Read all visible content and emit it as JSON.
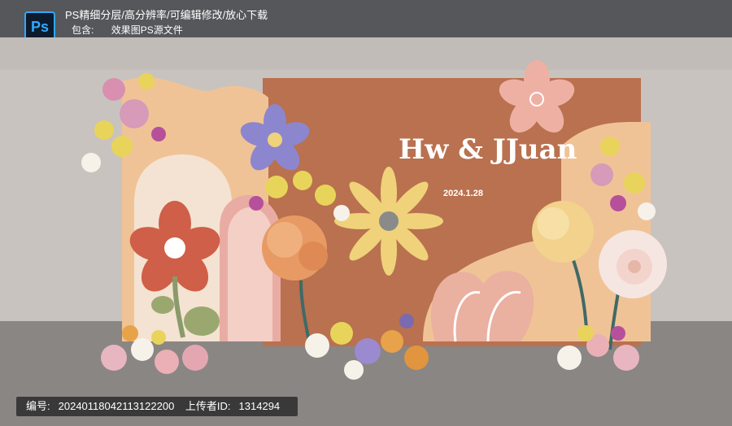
{
  "header": {
    "app_badge": "Ps",
    "title": "PS精细分层/高分辨率/可编辑修改/放心下载",
    "contains_label": "包含:",
    "contains_value": "效果图PS源文件"
  },
  "backdrop": {
    "names": "Hw & JJuan",
    "date": "2024.1.28"
  },
  "footer": {
    "id_label": "编号:",
    "id_value": "20240118042113122200",
    "uploader_label": "上传者ID:",
    "uploader_value": "1314294"
  },
  "colors": {
    "wall": "#c9c4c0",
    "floor": "#8b8785",
    "terracotta": "#b9714f",
    "peach": "#f0c397",
    "cream": "#f4e3d2",
    "pink": "#e9aca4",
    "lavender": "#8c86cf",
    "coral": "#cf5f48",
    "yellow": "#efd27a"
  }
}
